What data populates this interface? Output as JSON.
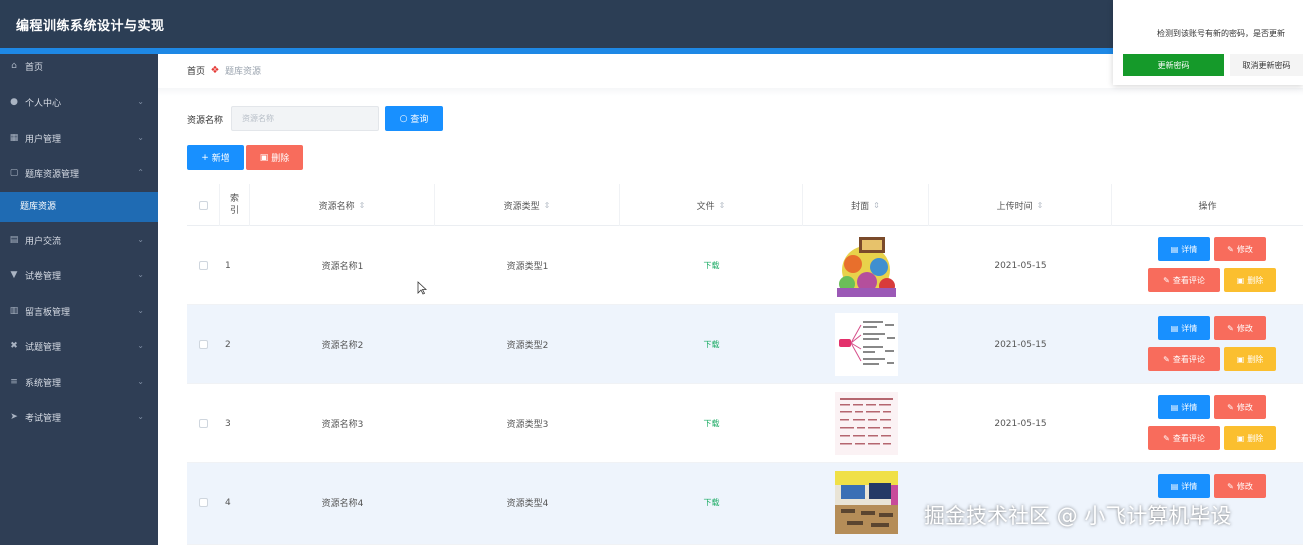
{
  "app": {
    "title": "编程训练系统设计与实现"
  },
  "sidebar": {
    "items": [
      {
        "label": "首页",
        "icon": "home-icon",
        "glyph": "⌂"
      },
      {
        "label": "个人中心",
        "icon": "user-icon",
        "glyph": "●"
      },
      {
        "label": "用户管理",
        "icon": "users-icon",
        "glyph": "▦"
      },
      {
        "label": "题库资源管理",
        "icon": "folder-icon",
        "glyph": "▢"
      },
      {
        "label": "用户交流",
        "icon": "chat-icon",
        "glyph": "▤"
      },
      {
        "label": "试卷管理",
        "icon": "paper-icon",
        "glyph": "▼"
      },
      {
        "label": "留言板管理",
        "icon": "board-icon",
        "glyph": "▥"
      },
      {
        "label": "试题管理",
        "icon": "question-icon",
        "glyph": "✖"
      },
      {
        "label": "系统管理",
        "icon": "settings-icon",
        "glyph": "≡"
      },
      {
        "label": "考试管理",
        "icon": "send-icon",
        "glyph": "➤"
      }
    ],
    "sub_item": "题库资源"
  },
  "breadcrumb": {
    "home": "首页",
    "current": "题库资源"
  },
  "search": {
    "label": "资源名称",
    "placeholder": "资源名称",
    "query_button": "查询"
  },
  "toolbar": {
    "add_button": "新增",
    "delete_button": "删除"
  },
  "table": {
    "headers": {
      "index": "索引",
      "name": "资源名称",
      "type": "资源类型",
      "file": "文件",
      "cover": "封面",
      "upload_time": "上传时间",
      "actions": "操作"
    },
    "rows": [
      {
        "index": "1",
        "name": "资源名称1",
        "type": "资源类型1",
        "file": "下载",
        "upload_time": "2021-05-15"
      },
      {
        "index": "2",
        "name": "资源名称2",
        "type": "资源类型2",
        "file": "下载",
        "upload_time": "2021-05-15"
      },
      {
        "index": "3",
        "name": "资源名称3",
        "type": "资源类型3",
        "file": "下载",
        "upload_time": "2021-05-15"
      },
      {
        "index": "4",
        "name": "资源名称4",
        "type": "资源类型4",
        "file": "下载",
        "upload_time": ""
      }
    ],
    "actions": {
      "detail": "详情",
      "edit": "修改",
      "review": "查看评论",
      "remove": "删除"
    }
  },
  "dialog": {
    "message": "检测到该账号有新的密码，是否更新",
    "confirm": "更新密码",
    "cancel": "取消更新密码"
  },
  "watermark": "掘金技术社区 @ 小飞计算机毕设",
  "colors": {
    "primary": "#1890ff",
    "danger": "#f86c5c",
    "warning": "#fbbf2f",
    "success": "#159a2a",
    "sidebar": "#2f3e55",
    "header": "#2c3e55"
  }
}
